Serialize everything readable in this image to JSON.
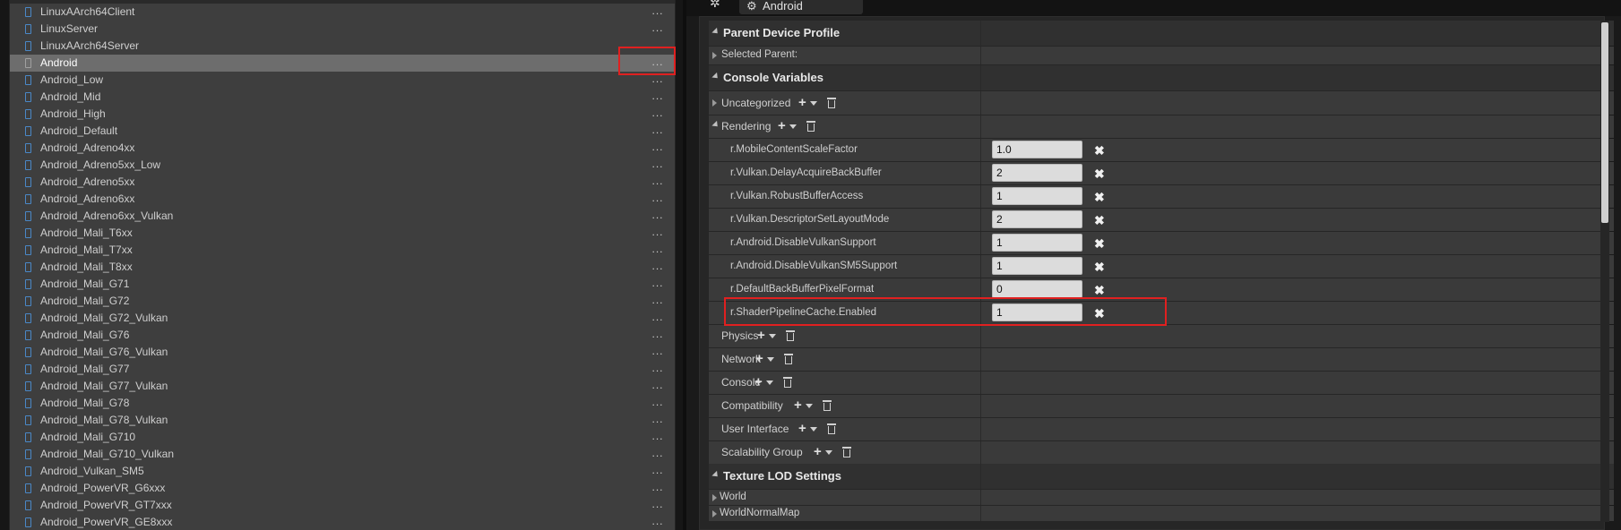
{
  "device_list": {
    "items": [
      {
        "label": "LinuxAArch64Client",
        "more": "..."
      },
      {
        "label": "LinuxServer",
        "more": "..."
      },
      {
        "label": "LinuxAArch64Server",
        "more": "..."
      },
      {
        "label": "Android",
        "more": "...",
        "selected": true
      },
      {
        "label": "Android_Low",
        "more": "..."
      },
      {
        "label": "Android_Mid",
        "more": "..."
      },
      {
        "label": "Android_High",
        "more": "..."
      },
      {
        "label": "Android_Default",
        "more": "..."
      },
      {
        "label": "Android_Adreno4xx",
        "more": "..."
      },
      {
        "label": "Android_Adreno5xx_Low",
        "more": "..."
      },
      {
        "label": "Android_Adreno5xx",
        "more": "..."
      },
      {
        "label": "Android_Adreno6xx",
        "more": "..."
      },
      {
        "label": "Android_Adreno6xx_Vulkan",
        "more": "..."
      },
      {
        "label": "Android_Mali_T6xx",
        "more": "..."
      },
      {
        "label": "Android_Mali_T7xx",
        "more": "..."
      },
      {
        "label": "Android_Mali_T8xx",
        "more": "..."
      },
      {
        "label": "Android_Mali_G71",
        "more": "..."
      },
      {
        "label": "Android_Mali_G72",
        "more": "..."
      },
      {
        "label": "Android_Mali_G72_Vulkan",
        "more": "..."
      },
      {
        "label": "Android_Mali_G76",
        "more": "..."
      },
      {
        "label": "Android_Mali_G76_Vulkan",
        "more": "..."
      },
      {
        "label": "Android_Mali_G77",
        "more": "..."
      },
      {
        "label": "Android_Mali_G77_Vulkan",
        "more": "..."
      },
      {
        "label": "Android_Mali_G78",
        "more": "..."
      },
      {
        "label": "Android_Mali_G78_Vulkan",
        "more": "..."
      },
      {
        "label": "Android_Mali_G710",
        "more": "..."
      },
      {
        "label": "Android_Mali_G710_Vulkan",
        "more": "..."
      },
      {
        "label": "Android_Vulkan_SM5",
        "more": "..."
      },
      {
        "label": "Android_PowerVR_G6xxx",
        "more": "..."
      },
      {
        "label": "Android_PowerVR_GT7xxx",
        "more": "..."
      },
      {
        "label": "Android_PowerVR_GE8xxx",
        "more": "..."
      }
    ]
  },
  "tab": {
    "title": "Android"
  },
  "details": {
    "parent_device_profile": {
      "header": "Parent Device Profile",
      "selected_parent_label": "Selected Parent:"
    },
    "console_variables": {
      "header": "Console Variables",
      "uncategorized_label": "Uncategorized",
      "rendering_label": "Rendering",
      "rendering_vars": [
        {
          "name": "r.MobileContentScaleFactor",
          "value": "1.0"
        },
        {
          "name": "r.Vulkan.DelayAcquireBackBuffer",
          "value": "2"
        },
        {
          "name": "r.Vulkan.RobustBufferAccess",
          "value": "1"
        },
        {
          "name": "r.Vulkan.DescriptorSetLayoutMode",
          "value": "2"
        },
        {
          "name": "r.Android.DisableVulkanSupport",
          "value": "1"
        },
        {
          "name": "r.Android.DisableVulkanSM5Support",
          "value": "1"
        },
        {
          "name": "r.DefaultBackBufferPixelFormat",
          "value": "0"
        },
        {
          "name": "r.ShaderPipelineCache.Enabled",
          "value": "1"
        }
      ],
      "other_categories": [
        {
          "label": "Physics"
        },
        {
          "label": "Network"
        },
        {
          "label": "Console"
        },
        {
          "label": "Compatibility"
        },
        {
          "label": "User Interface"
        },
        {
          "label": "Scalability Group"
        }
      ]
    },
    "texture_lod_settings": {
      "header": "Texture LOD Settings",
      "items": [
        {
          "label": "World"
        },
        {
          "label": "WorldNormalMap"
        }
      ]
    }
  },
  "colors": {
    "highlight": "#e02020",
    "selected_row": "#6d6d6d",
    "device_icon": "#4a88c7",
    "input_bg": "#dcdcdc"
  },
  "icons": {
    "device": "device-icon",
    "more": "ellipsis-icon",
    "add": "plus-icon",
    "delete": "trash-icon",
    "clear": "close-icon",
    "tab": "gear-icon",
    "engine": "unreal-logo-icon"
  }
}
